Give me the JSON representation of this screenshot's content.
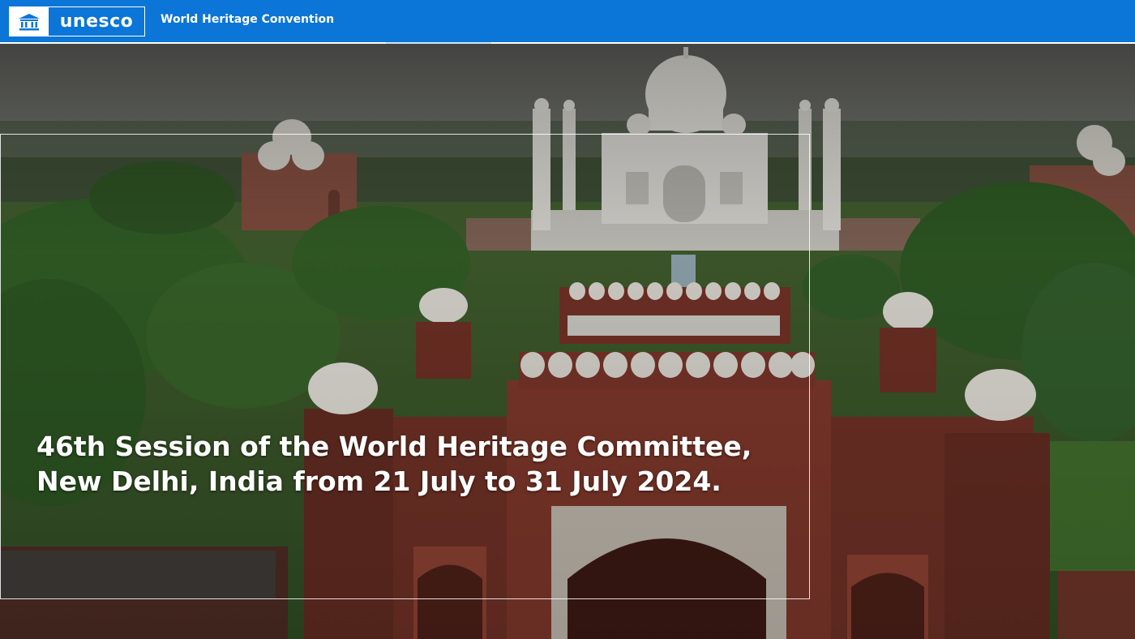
{
  "header": {
    "logo_text": "unesco",
    "site_title": "World Heritage Convention",
    "accent_color": "#0b75d8"
  },
  "hero": {
    "headline": "46th Session of the World Heritage Committee, New Delhi, India from 21 July to 31 July 2024."
  }
}
